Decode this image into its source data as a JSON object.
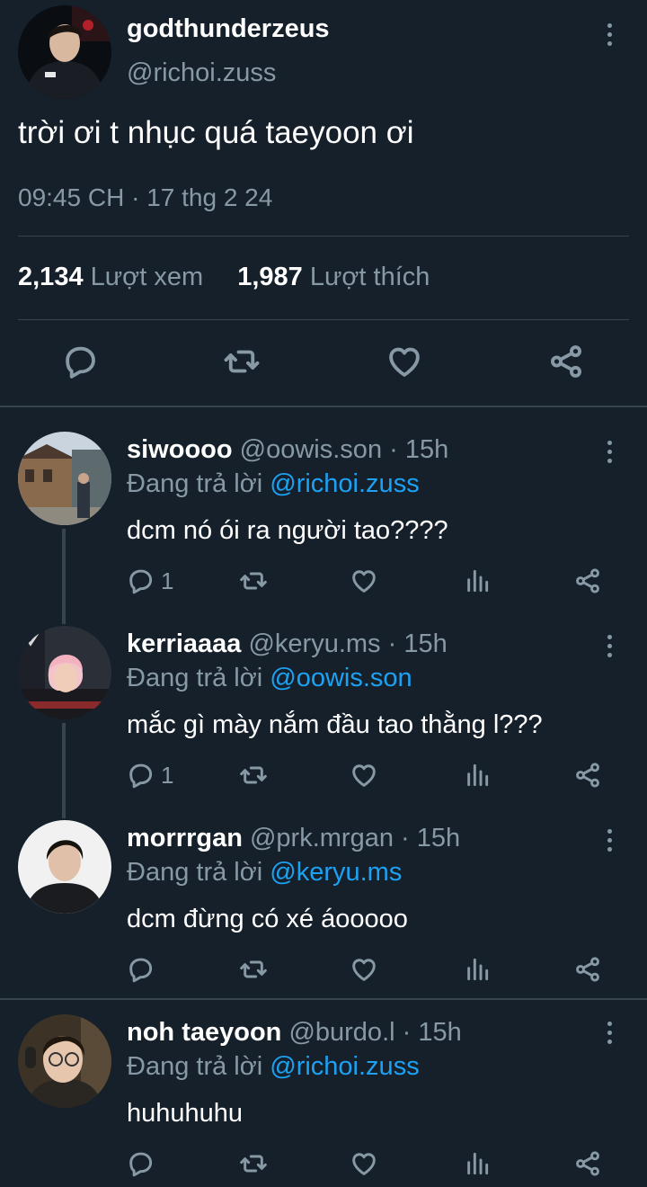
{
  "tweet": {
    "display_name": "godthunderzeus",
    "handle": "@richoi.zuss",
    "text": "trời ơi t nhục quá taeyoon ơi",
    "time": "09:45 CH",
    "date": "17 thg 2 24",
    "views_count": "2,134",
    "views_label": "Lượt xem",
    "likes_count": "1,987",
    "likes_label": "Lượt thích"
  },
  "replies": [
    {
      "name": "siwoooo",
      "handle": "@oowis.son",
      "age": "15h",
      "replying_label": "Đang trả lời",
      "replying_to": "@richoi.zuss",
      "text": "dcm nó ói ra người tao????",
      "reply_count": "1"
    },
    {
      "name": "kerriaaaa",
      "handle": "@keryu.ms",
      "age": "15h",
      "replying_label": "Đang trả lời",
      "replying_to": "@oowis.son",
      "text": "mắc gì mày nắm đầu tao thằng l???",
      "reply_count": "1"
    },
    {
      "name": "morrrgan",
      "handle": "@prk.mrgan",
      "age": "15h",
      "replying_label": "Đang trả lời",
      "replying_to": "@keryu.ms",
      "text": "dcm đừng có xé áooooo",
      "reply_count": ""
    },
    {
      "name": "noh taeyoon",
      "handle": "@burdo.l",
      "age": "15h",
      "replying_label": "Đang trả lời",
      "replying_to": "@richoi.zuss",
      "text": "huhuhuhu",
      "reply_count": ""
    }
  ],
  "colors": {
    "background": "#15202b",
    "muted": "#8899a6",
    "link": "#1da1f2",
    "divider": "#38444d"
  },
  "icons": [
    "reply-icon",
    "retweet-icon",
    "like-icon",
    "share-icon",
    "views-icon",
    "more-icon"
  ]
}
